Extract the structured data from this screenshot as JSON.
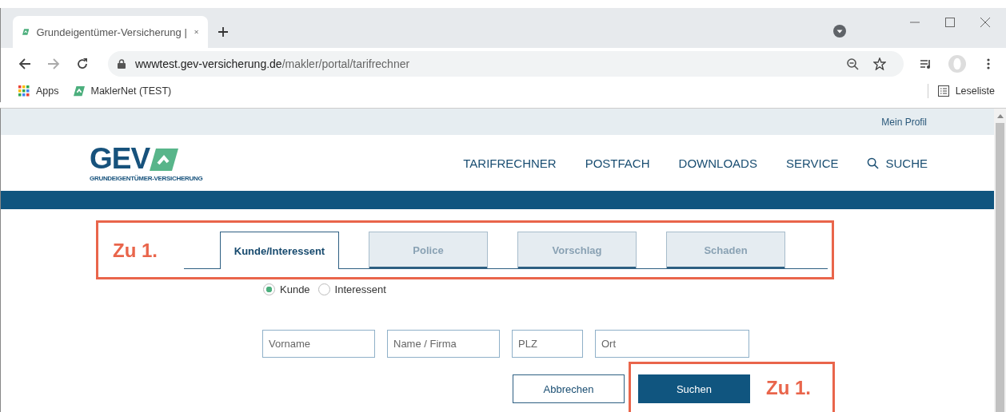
{
  "browser": {
    "tab_title": "Grundeigentümer-Versicherung |",
    "url_host": "wwwtest.gev-versicherung.de",
    "url_path": "/makler/portal/tarifrechner",
    "bookmarks": [
      "Apps",
      "MaklerNet (TEST)"
    ],
    "reading_list": "Leseliste"
  },
  "site": {
    "profile_link": "Mein Profil",
    "logo_text": "GEV",
    "logo_tagline": "GRUNDEIGENTÜMER-VERSICHERUNG",
    "nav": [
      {
        "label": "TARIFRECHNER",
        "kind": "link"
      },
      {
        "label": "POSTFACH",
        "kind": "link"
      },
      {
        "label": "DOWNLOADS",
        "kind": "link"
      },
      {
        "label": "SERVICE",
        "kind": "link"
      },
      {
        "label": "SUCHE",
        "kind": "search"
      }
    ]
  },
  "tabs": [
    {
      "label": "Kunde/Interessent",
      "selected": true
    },
    {
      "label": "Police",
      "selected": false
    },
    {
      "label": "Vorschlag",
      "selected": false
    },
    {
      "label": "Schaden",
      "selected": false
    }
  ],
  "customer_type": [
    {
      "label": "Kunde",
      "selected": true
    },
    {
      "label": "Interessent",
      "selected": false
    }
  ],
  "search_fields": [
    {
      "placeholder": "Vorname"
    },
    {
      "placeholder": "Name / Firma"
    },
    {
      "placeholder": "PLZ"
    },
    {
      "placeholder": "Ort"
    }
  ],
  "buttons": [
    {
      "label": "Abbrechen",
      "kind": "secondary"
    },
    {
      "label": "Suchen",
      "kind": "primary"
    }
  ],
  "annotations": [
    {
      "text": "Zu 1."
    },
    {
      "text": "Zu 1."
    }
  ]
}
